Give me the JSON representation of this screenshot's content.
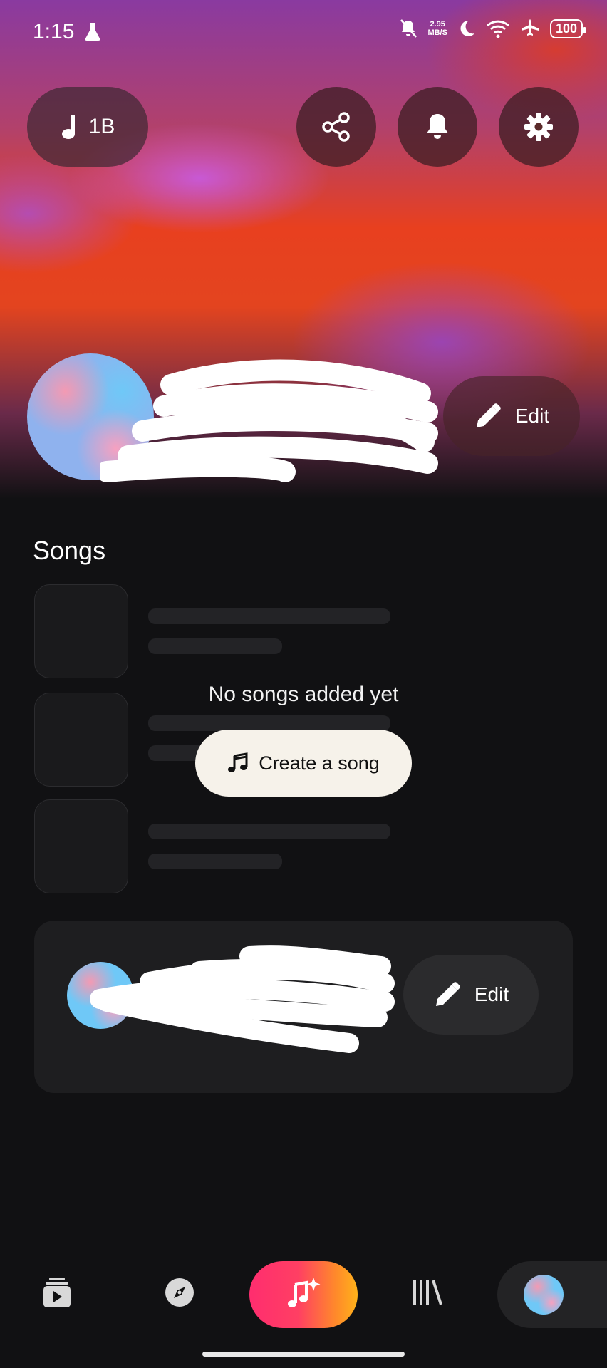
{
  "status_bar": {
    "time": "1:15",
    "net_speed_value": "2.95",
    "net_speed_unit": "MB/S",
    "battery": "100"
  },
  "header": {
    "song_count": "1B"
  },
  "profile": {
    "edit_label": "Edit"
  },
  "songs": {
    "title": "Songs",
    "empty_text": "No songs added yet",
    "create_button_label": "Create a song"
  },
  "profile_card": {
    "edit_label": "Edit"
  },
  "nav": {
    "items": [
      "play-queue-icon",
      "explore-icon",
      "create-icon",
      "library-icon",
      "profile-avatar"
    ]
  },
  "colors": {
    "background": "#111113",
    "create_gradient_start": "#ff2d6f",
    "create_gradient_end": "#ffb21a",
    "create_song_button_bg": "#f6f2ea"
  }
}
